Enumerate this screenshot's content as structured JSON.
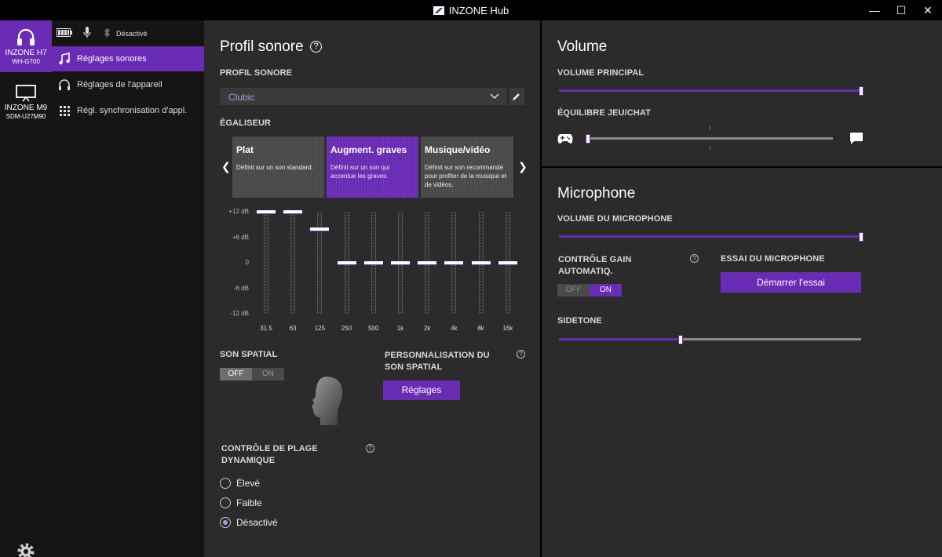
{
  "window": {
    "title": "INZONE Hub",
    "min": "—",
    "max": "☐",
    "close": "✕"
  },
  "devices": [
    {
      "name1": "INZONE H7",
      "name2": "WH-G700",
      "icon": "headset-icon"
    },
    {
      "name1": "INZONE M9",
      "name2": "SDM-U27M90",
      "icon": "monitor-icon"
    }
  ],
  "status": {
    "bluetooth": "Désactivé"
  },
  "sidebar": {
    "items": [
      {
        "label": "Réglages sonores"
      },
      {
        "label": "Réglages de l'appareil"
      },
      {
        "label": "Régl. synchronisation d'appl."
      }
    ]
  },
  "profile": {
    "heading": "Profil sonore",
    "section_label": "PROFIL SONORE",
    "dropdown_value": "Clubic"
  },
  "equalizer": {
    "section_label": "ÉGALISEUR",
    "presets": [
      {
        "title": "Plat",
        "desc": "Définit sur un son standard."
      },
      {
        "title": "Augment. graves",
        "desc": "Définit sur un son qui accentue les graves."
      },
      {
        "title": "Musique/vidéo",
        "desc": "Définit sur son recommandé pour profiter de la musique et de vidéos."
      }
    ],
    "selected_preset": "Augment. graves",
    "y_labels": [
      "+12 dB",
      "+6 dB",
      "0",
      "-6 dB",
      "-12 dB"
    ],
    "bands": [
      "31.5",
      "63",
      "125",
      "250",
      "500",
      "1k",
      "2k",
      "4k",
      "8k",
      "16k"
    ],
    "gains_db": [
      12,
      12,
      8,
      0,
      0,
      0,
      0,
      0,
      0,
      0
    ],
    "range_db": [
      -12,
      12
    ]
  },
  "spatial": {
    "label": "SON SPATIAL",
    "toggle_off": "OFF",
    "toggle_on": "ON",
    "state": "OFF",
    "custom_label": "PERSONNALISATION DU SON SPATIAL",
    "settings_button": "Réglages"
  },
  "dynamic_range": {
    "label": "CONTRÔLE DE PLAGE DYNAMIQUE",
    "options": [
      "Élevé",
      "Faible",
      "Désactivé"
    ],
    "selected": "Désactivé"
  },
  "volume": {
    "heading": "Volume",
    "main_label": "VOLUME PRINCIPAL",
    "main_level": 1.0,
    "balance_label": "ÉQUILIBRE JEU/CHAT",
    "balance_level": 0.0
  },
  "microphone": {
    "heading": "Microphone",
    "volume_label": "VOLUME DU MICROPHONE",
    "volume_level": 1.0,
    "agc_label": "CONTRÔLE GAIN AUTOMATIQ.",
    "agc_off": "OFF",
    "agc_on": "ON",
    "agc_state": "ON",
    "test_label": "ESSAI DU MICROPHONE",
    "test_button": "Démarrer l'essai",
    "sidetone_label": "SIDETONE",
    "sidetone_level": 0.4
  },
  "colors": {
    "accent": "#6a2bb5",
    "accent_text": "#b690e6",
    "panel": "#2b2b2b",
    "sidebar": "#151515"
  }
}
